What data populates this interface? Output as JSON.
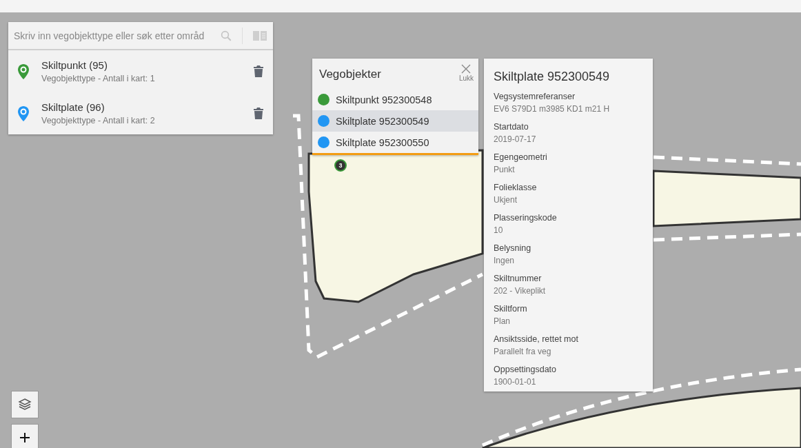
{
  "search": {
    "placeholder": "Skriv inn vegobjekttype eller søk etter områd"
  },
  "layers": [
    {
      "name": "Skiltpunkt (95)",
      "subtitle": "Vegobjekttype - Antall i kart: 1",
      "color": "#3a9a3a"
    },
    {
      "name": "Skiltplate (96)",
      "subtitle": "Vegobjekttype - Antall i kart: 2",
      "color": "#2196f3"
    }
  ],
  "popup": {
    "title": "Vegobjekter",
    "close_label": "Lukk",
    "items": [
      {
        "label": "Skiltpunkt 952300548",
        "color": "#3a9a3a",
        "selected": false
      },
      {
        "label": "Skiltplate 952300549",
        "color": "#2196f3",
        "selected": true
      },
      {
        "label": "Skiltplate 952300550",
        "color": "#2196f3",
        "selected": false
      }
    ]
  },
  "cluster": {
    "count": "3"
  },
  "details": {
    "title": "Skiltplate 952300549",
    "fields": [
      {
        "label": "Vegsystemreferanser",
        "value": "EV6 S79D1 m3985 KD1 m21 H"
      },
      {
        "label": "Startdato",
        "value": "2019-07-17"
      },
      {
        "label": "Egengeometri",
        "value": "Punkt"
      },
      {
        "label": "Folieklasse",
        "value": "Ukjent"
      },
      {
        "label": "Plasseringskode",
        "value": "10"
      },
      {
        "label": "Belysning",
        "value": "Ingen"
      },
      {
        "label": "Skiltnummer",
        "value": "202 - Vikeplikt"
      },
      {
        "label": "Skiltform",
        "value": "Plan"
      },
      {
        "label": "Ansiktsside, rettet mot",
        "value": "Parallelt fra veg"
      },
      {
        "label": "Oppsettingsdato",
        "value": "1900-01-01"
      }
    ]
  }
}
